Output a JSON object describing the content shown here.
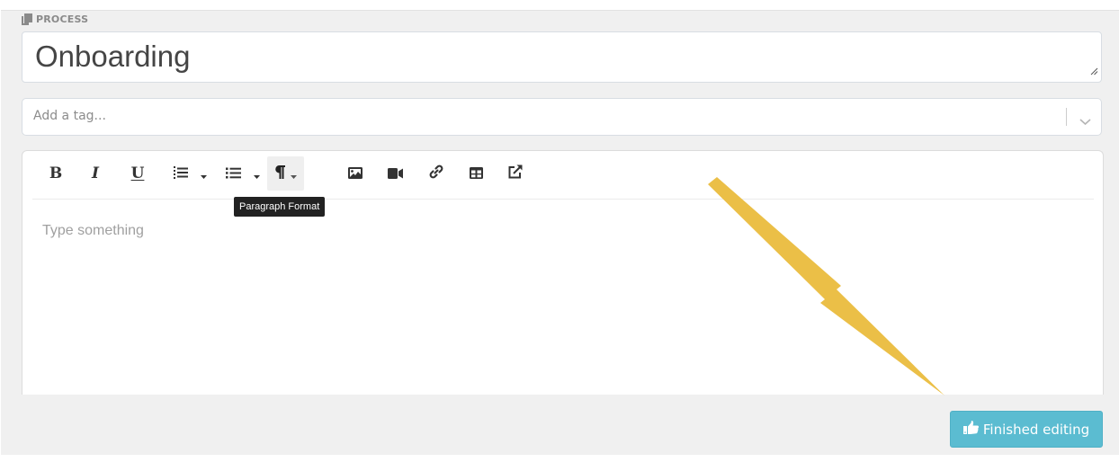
{
  "section": {
    "label": "PROCESS",
    "icon": "copy-icon"
  },
  "title_field": {
    "value": "Onboarding"
  },
  "tag_field": {
    "placeholder": "Add a tag..."
  },
  "editor": {
    "toolbar": [
      {
        "name": "bold",
        "label": "B"
      },
      {
        "name": "italic",
        "label": "I"
      },
      {
        "name": "underline",
        "label": "U"
      },
      {
        "name": "ordered-list",
        "icon": "ordered-list-icon",
        "has_dropdown": true
      },
      {
        "name": "unordered-list",
        "icon": "unordered-list-icon",
        "has_dropdown": true
      },
      {
        "name": "paragraph-format",
        "icon": "paragraph-icon",
        "has_dropdown": true,
        "active": true
      },
      {
        "name": "insert-image",
        "icon": "image-icon"
      },
      {
        "name": "insert-video",
        "icon": "video-icon"
      },
      {
        "name": "insert-link",
        "icon": "link-icon"
      },
      {
        "name": "insert-table",
        "icon": "table-icon"
      },
      {
        "name": "open-external",
        "icon": "external-link-icon"
      }
    ],
    "tooltip": "Paragraph Format",
    "placeholder": "Type something"
  },
  "finish_button": {
    "label": "Finished editing",
    "icon": "thumbs-up-icon"
  },
  "annotation": {
    "type": "arrow",
    "color": "#ebbf47",
    "points_to": "finish_button"
  },
  "colors": {
    "accent": "#5bbcd1",
    "panel_bg": "#f0f0f0",
    "tooltip_bg": "#222222"
  }
}
